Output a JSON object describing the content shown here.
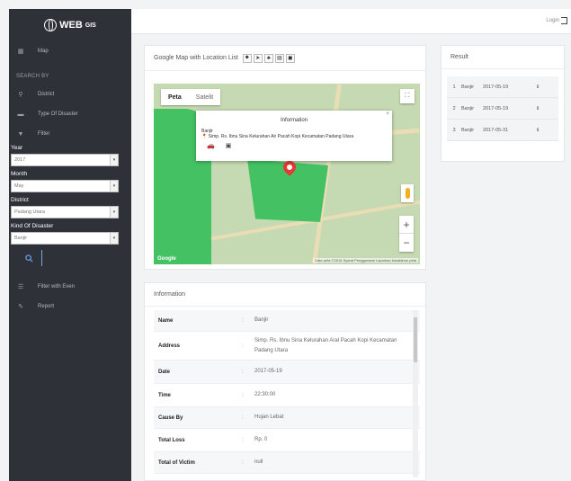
{
  "sidebar": {
    "logo_text": "WEB",
    "logo_sub": "GIS",
    "map_item": {
      "label": "Map",
      "icon": "map-icon"
    },
    "search_title": "SEARCH BY",
    "search_items": [
      {
        "label": "District",
        "icon": "pin-icon"
      },
      {
        "label": "Type Of Disaster",
        "icon": "folder-icon"
      },
      {
        "label": "Filter",
        "icon": "filter-icon"
      }
    ],
    "fields": [
      {
        "label": "Year",
        "value": "2017"
      },
      {
        "label": "Month",
        "value": "May"
      },
      {
        "label": "District",
        "value": "Padang Utara"
      },
      {
        "label": "Kind Of Disaster",
        "value": "Banjir"
      }
    ],
    "bottom_items": [
      {
        "label": "Filter with Even",
        "icon": "list-icon"
      },
      {
        "label": "Report",
        "icon": "report-icon"
      }
    ]
  },
  "topbar": {
    "login_label": "Login"
  },
  "map_panel": {
    "title": "Google Map with Location List",
    "tools": [
      "⬥",
      "➤",
      "♣",
      "▤",
      "◼"
    ],
    "tab_map": "Peta",
    "tab_satellite": "Satelit",
    "google_label": "Google",
    "attribution": "Data peta ©2016   Syarat Penggunaan   Laporkan kesalahan peta",
    "infowindow": {
      "title": "Information",
      "name": "Banjir",
      "address": "Simp. Rs. Ibnu Sina Kelurahan Air Pacah Kopi Kecamatan Padang Utara"
    }
  },
  "result_panel": {
    "title": "Result",
    "rows": [
      {
        "no": "1",
        "name": "Banjir",
        "date": "2017-05-19"
      },
      {
        "no": "2",
        "name": "Banjir",
        "date": "2017-05-19"
      },
      {
        "no": "3",
        "name": "Banjir",
        "date": "2017-05-31"
      }
    ]
  },
  "info_panel": {
    "title": "Information",
    "separator": ":",
    "rows": [
      {
        "key": "Name",
        "value": "Banjir"
      },
      {
        "key": "Address",
        "value": "Simp. Rs. Ibnu Sina Kelurahan Aral Pacah Kopi Kecamatan Padang Utara"
      },
      {
        "key": "Date",
        "value": "2017-05-19"
      },
      {
        "key": "Time",
        "value": "22:30:00"
      },
      {
        "key": "Cause By",
        "value": "Hujan Lebat"
      },
      {
        "key": "Total Loss",
        "value": "Rp. 0"
      },
      {
        "key": "Total of Victim",
        "value": "null"
      }
    ]
  }
}
